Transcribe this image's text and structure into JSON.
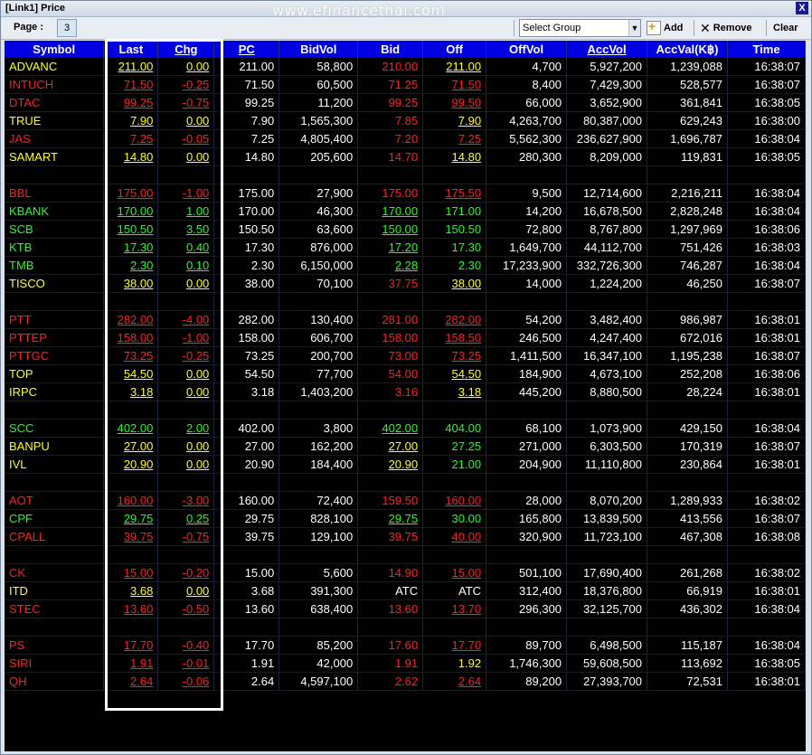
{
  "window": {
    "title": "[Link1] Price",
    "watermark": "www.efinancethai.com",
    "close_label": "X"
  },
  "toolbar": {
    "page_label": "Page :",
    "page_value": "3",
    "group_value": "Select Group",
    "add_label": "Add",
    "remove_label": "Remove",
    "clear_label": "Clear"
  },
  "colors": {
    "up": "#20ff20",
    "down": "#ff2020",
    "unchanged": "#ffff20",
    "header_bg": "#0000e0"
  },
  "columns": [
    "Symbol",
    "Last",
    "Chg",
    "PC",
    "BidVol",
    "Bid",
    "Off",
    "OffVol",
    "AccVol",
    "AccVal(K฿)",
    "Time"
  ],
  "rows": [
    {
      "blank": false,
      "c": "y",
      "bc": "r",
      "oc": "y",
      "v": [
        "ADVANC",
        "211.00",
        "0.00",
        "211.00",
        "58,800",
        "210.00",
        "211.00",
        "4,700",
        "5,927,200",
        "1,239,088",
        "16:38:07"
      ]
    },
    {
      "blank": false,
      "c": "r",
      "bc": "r",
      "oc": "r",
      "v": [
        "INTUCH",
        "71.50",
        "-0.25",
        "71.50",
        "60,500",
        "71.25",
        "71.50",
        "8,400",
        "7,429,300",
        "528,577",
        "16:38:07"
      ]
    },
    {
      "blank": false,
      "c": "r",
      "bc": "r",
      "oc": "r",
      "v": [
        "DTAC",
        "99.25",
        "-0.75",
        "99.25",
        "11,200",
        "99.25",
        "99.50",
        "66,000",
        "3,652,900",
        "361,841",
        "16:38:05"
      ]
    },
    {
      "blank": false,
      "c": "y",
      "bc": "r",
      "oc": "y",
      "v": [
        "TRUE",
        "7.90",
        "0.00",
        "7.90",
        "1,565,300",
        "7.85",
        "7.90",
        "4,263,700",
        "80,387,000",
        "629,243",
        "16:38:00"
      ]
    },
    {
      "blank": false,
      "c": "r",
      "bc": "r",
      "oc": "r",
      "v": [
        "JAS",
        "7.25",
        "-0.05",
        "7.25",
        "4,805,400",
        "7.20",
        "7.25",
        "5,562,300",
        "236,627,900",
        "1,696,787",
        "16:38:04"
      ]
    },
    {
      "blank": false,
      "c": "y",
      "bc": "r",
      "oc": "y",
      "v": [
        "SAMART",
        "14.80",
        "0.00",
        "14.80",
        "205,600",
        "14.70",
        "14.80",
        "280,300",
        "8,209,000",
        "119,831",
        "16:38:05"
      ]
    },
    {
      "blank": true,
      "c": "w",
      "bc": "w",
      "oc": "w",
      "v": [
        "",
        "",
        "",
        "",
        "",
        "",
        "",
        "",
        "",
        "",
        ""
      ]
    },
    {
      "blank": false,
      "c": "r",
      "bc": "r",
      "oc": "r",
      "v": [
        "BBL",
        "175.00",
        "-1.00",
        "175.00",
        "27,900",
        "175.00",
        "175.50",
        "9,500",
        "12,714,600",
        "2,216,211",
        "16:38:04"
      ]
    },
    {
      "blank": false,
      "c": "g",
      "bc": "g",
      "oc": "g",
      "v": [
        "KBANK",
        "170.00",
        "1.00",
        "170.00",
        "46,300",
        "170.00",
        "171.00",
        "14,200",
        "16,678,500",
        "2,828,248",
        "16:38:04"
      ]
    },
    {
      "blank": false,
      "c": "g",
      "bc": "g",
      "oc": "g",
      "v": [
        "SCB",
        "150.50",
        "3.50",
        "150.50",
        "63,600",
        "150.00",
        "150.50",
        "72,800",
        "8,767,800",
        "1,297,969",
        "16:38:06"
      ]
    },
    {
      "blank": false,
      "c": "g",
      "bc": "g",
      "oc": "g",
      "v": [
        "KTB",
        "17.30",
        "0.40",
        "17.30",
        "876,000",
        "17.20",
        "17.30",
        "1,649,700",
        "44,112,700",
        "751,426",
        "16:38:03"
      ]
    },
    {
      "blank": false,
      "c": "g",
      "bc": "g",
      "oc": "g",
      "v": [
        "TMB",
        "2.30",
        "0.10",
        "2.30",
        "6,150,000",
        "2.28",
        "2.30",
        "17,233,900",
        "332,726,300",
        "746,287",
        "16:38:04"
      ]
    },
    {
      "blank": false,
      "c": "y",
      "bc": "r",
      "oc": "y",
      "v": [
        "TISCO",
        "38.00",
        "0.00",
        "38.00",
        "70,100",
        "37.75",
        "38.00",
        "14,000",
        "1,224,200",
        "46,250",
        "16:38:07"
      ]
    },
    {
      "blank": true,
      "c": "w",
      "bc": "w",
      "oc": "w",
      "v": [
        "",
        "",
        "",
        "",
        "",
        "",
        "",
        "",
        "",
        "",
        ""
      ]
    },
    {
      "blank": false,
      "c": "r",
      "bc": "r",
      "oc": "r",
      "v": [
        "PTT",
        "282.00",
        "-4.00",
        "282.00",
        "130,400",
        "281.00",
        "282.00",
        "54,200",
        "3,482,400",
        "986,987",
        "16:38:01"
      ]
    },
    {
      "blank": false,
      "c": "r",
      "bc": "r",
      "oc": "r",
      "v": [
        "PTTEP",
        "158.00",
        "-1.00",
        "158.00",
        "606,700",
        "158.00",
        "158.50",
        "246,500",
        "4,247,400",
        "672,016",
        "16:38:01"
      ]
    },
    {
      "blank": false,
      "c": "r",
      "bc": "r",
      "oc": "r",
      "v": [
        "PTTGC",
        "73.25",
        "-0.25",
        "73.25",
        "200,700",
        "73.00",
        "73.25",
        "1,411,500",
        "16,347,100",
        "1,195,238",
        "16:38:07"
      ]
    },
    {
      "blank": false,
      "c": "y",
      "bc": "r",
      "oc": "y",
      "v": [
        "TOP",
        "54.50",
        "0.00",
        "54.50",
        "77,700",
        "54.00",
        "54.50",
        "184,900",
        "4,673,100",
        "252,208",
        "16:38:06"
      ]
    },
    {
      "blank": false,
      "c": "y",
      "bc": "r",
      "oc": "y",
      "v": [
        "IRPC",
        "3.18",
        "0.00",
        "3.18",
        "1,403,200",
        "3.16",
        "3.18",
        "445,200",
        "8,880,500",
        "28,224",
        "16:38:01"
      ]
    },
    {
      "blank": true,
      "c": "w",
      "bc": "w",
      "oc": "w",
      "v": [
        "",
        "",
        "",
        "",
        "",
        "",
        "",
        "",
        "",
        "",
        ""
      ]
    },
    {
      "blank": false,
      "c": "g",
      "bc": "g",
      "oc": "g",
      "v": [
        "SCC",
        "402.00",
        "2.00",
        "402.00",
        "3,800",
        "402.00",
        "404.00",
        "68,100",
        "1,073,900",
        "429,150",
        "16:38:04"
      ]
    },
    {
      "blank": false,
      "c": "y",
      "bc": "y",
      "oc": "g",
      "v": [
        "BANPU",
        "27.00",
        "0.00",
        "27.00",
        "162,200",
        "27.00",
        "27.25",
        "271,000",
        "6,303,500",
        "170,319",
        "16:38:07"
      ]
    },
    {
      "blank": false,
      "c": "y",
      "bc": "y",
      "oc": "g",
      "v": [
        "IVL",
        "20.90",
        "0.00",
        "20.90",
        "184,400",
        "20.90",
        "21.00",
        "204,900",
        "11,110,800",
        "230,864",
        "16:38:01"
      ]
    },
    {
      "blank": true,
      "c": "w",
      "bc": "w",
      "oc": "w",
      "v": [
        "",
        "",
        "",
        "",
        "",
        "",
        "",
        "",
        "",
        "",
        ""
      ]
    },
    {
      "blank": false,
      "c": "r",
      "bc": "r",
      "oc": "r",
      "v": [
        "AOT",
        "160.00",
        "-3.00",
        "160.00",
        "72,400",
        "159.50",
        "160.00",
        "28,000",
        "8,070,200",
        "1,289,933",
        "16:38:02"
      ]
    },
    {
      "blank": false,
      "c": "g",
      "bc": "g",
      "oc": "g",
      "v": [
        "CPF",
        "29.75",
        "0.25",
        "29.75",
        "828,100",
        "29.75",
        "30.00",
        "165,800",
        "13,839,500",
        "413,556",
        "16:38:07"
      ]
    },
    {
      "blank": false,
      "c": "r",
      "bc": "r",
      "oc": "r",
      "v": [
        "CPALL",
        "39.75",
        "-0.75",
        "39.75",
        "129,100",
        "39.75",
        "40.00",
        "320,900",
        "11,723,100",
        "467,308",
        "16:38:08"
      ]
    },
    {
      "blank": true,
      "c": "w",
      "bc": "w",
      "oc": "w",
      "v": [
        "",
        "",
        "",
        "",
        "",
        "",
        "",
        "",
        "",
        "",
        ""
      ]
    },
    {
      "blank": false,
      "c": "r",
      "bc": "r",
      "oc": "r",
      "v": [
        "CK",
        "15.00",
        "-0.20",
        "15.00",
        "5,600",
        "14.90",
        "15.00",
        "501,100",
        "17,690,400",
        "261,268",
        "16:38:02"
      ]
    },
    {
      "blank": false,
      "c": "y",
      "bc": "w",
      "oc": "w",
      "v": [
        "ITD",
        "3.68",
        "0.00",
        "3.68",
        "391,300",
        "ATC",
        "ATC",
        "312,400",
        "18,376,800",
        "66,919",
        "16:38:01"
      ]
    },
    {
      "blank": false,
      "c": "r",
      "bc": "r",
      "oc": "r",
      "v": [
        "STEC",
        "13.60",
        "-0.50",
        "13.60",
        "638,400",
        "13.60",
        "13.70",
        "296,300",
        "32,125,700",
        "436,302",
        "16:38:04"
      ]
    },
    {
      "blank": true,
      "c": "w",
      "bc": "w",
      "oc": "w",
      "v": [
        "",
        "",
        "",
        "",
        "",
        "",
        "",
        "",
        "",
        "",
        ""
      ]
    },
    {
      "blank": false,
      "c": "r",
      "bc": "r",
      "oc": "r",
      "v": [
        "PS",
        "17.70",
        "-0.40",
        "17.70",
        "85,200",
        "17.60",
        "17.70",
        "89,700",
        "6,498,500",
        "115,187",
        "16:38:04"
      ]
    },
    {
      "blank": false,
      "c": "r",
      "bc": "r",
      "oc": "y",
      "v": [
        "SIRI",
        "1.91",
        "-0.01",
        "1.91",
        "42,000",
        "1.91",
        "1.92",
        "1,746,300",
        "59,608,500",
        "113,692",
        "16:38:05"
      ]
    },
    {
      "blank": false,
      "c": "r",
      "bc": "r",
      "oc": "r",
      "v": [
        "QH",
        "2.64",
        "-0.06",
        "2.64",
        "4,597,100",
        "2.62",
        "2.64",
        "89,200",
        "27,393,700",
        "72,531",
        "16:38:01"
      ]
    }
  ]
}
